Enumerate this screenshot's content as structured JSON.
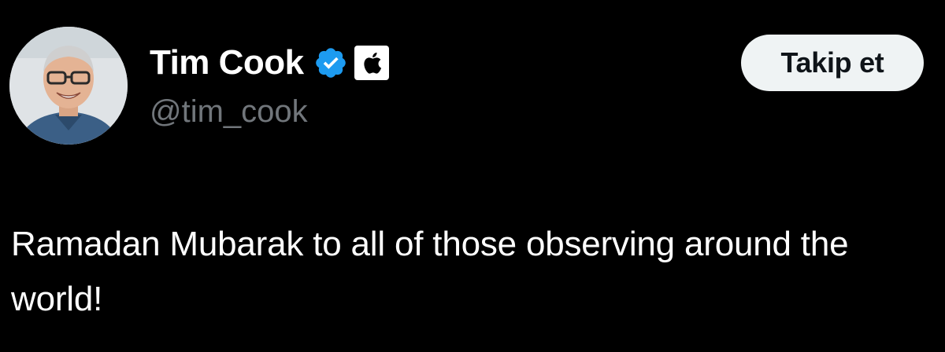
{
  "author": {
    "display_name": "Tim Cook",
    "handle": "@tim_cook",
    "verified": true,
    "affiliate": "apple-logo-icon"
  },
  "follow_button": {
    "label": "Takip et"
  },
  "tweet": {
    "text": "Ramadan Mubarak to all of those observing around the world!"
  },
  "colors": {
    "background": "#000000",
    "text_primary": "#ffffff",
    "text_secondary": "#71767b",
    "verified_blue": "#1d9bf0",
    "button_bg": "#eff3f4",
    "button_text": "#0f1419"
  },
  "icons": {
    "verified": "verified-badge-icon",
    "affiliate": "apple-logo-icon"
  }
}
